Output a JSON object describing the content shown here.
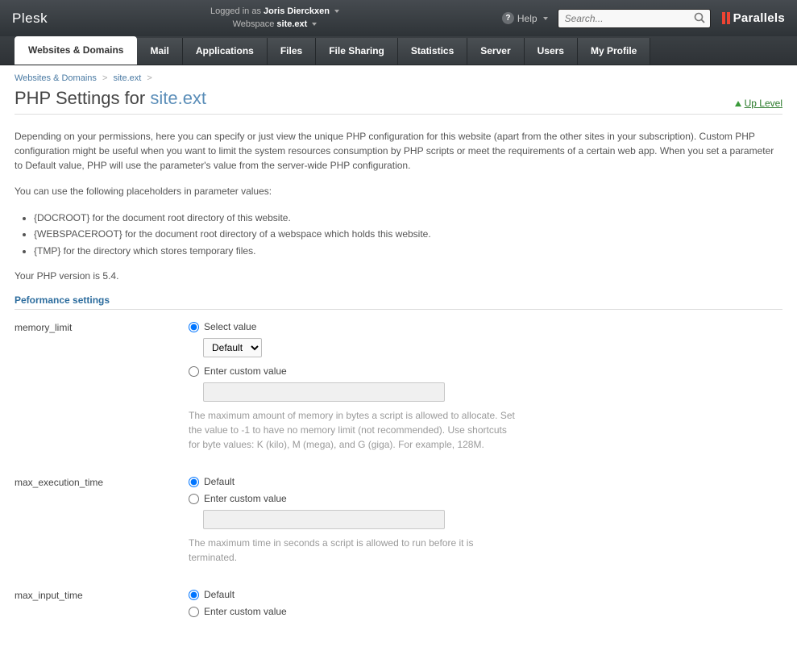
{
  "header": {
    "brand": "Plesk",
    "logged_in_label": "Logged in as",
    "user": "Joris Dierckxen",
    "webspace_label": "Webspace",
    "webspace": "site.ext",
    "help": "Help",
    "search_placeholder": "Search...",
    "parallels": "Parallels"
  },
  "nav": {
    "tabs": [
      {
        "label": "Websites & Domains",
        "active": true
      },
      {
        "label": "Mail"
      },
      {
        "label": "Applications"
      },
      {
        "label": "Files"
      },
      {
        "label": "File Sharing"
      },
      {
        "label": "Statistics"
      },
      {
        "label": "Server"
      },
      {
        "label": "Users"
      },
      {
        "label": "My Profile"
      }
    ]
  },
  "breadcrumbs": {
    "items": [
      {
        "label": "Websites & Domains"
      },
      {
        "label": "site.ext"
      }
    ]
  },
  "page": {
    "title_prefix": "PHP Settings for ",
    "title_ext": "site.ext",
    "up_level": "Up Level",
    "description": "Depending on your permissions, here you can specify or just view the unique PHP configuration for this website (apart from the other sites in your subscription). Custom PHP configuration might be useful when you want to limit the system resources consumption by PHP scripts or meet the requirements of a certain web app. When you set a parameter to Default value, PHP will use the parameter's value from the server-wide PHP configuration.",
    "placeholders_intro": "You can use the following placeholders in parameter values:",
    "placeholders": [
      "{DOCROOT} for the document root directory of this website.",
      "{WEBSPACEROOT} for the document root directory of a webspace which holds this website.",
      "{TMP} for the directory which stores temporary files."
    ],
    "php_version": "Your PHP version is 5.4.",
    "section_title": "Peformance settings"
  },
  "settings": {
    "memory_limit": {
      "label": "memory_limit",
      "opt1": "Select value",
      "select_value": "Default",
      "opt2": "Enter custom value",
      "hint": "The maximum amount of memory in bytes a script is allowed to allocate. Set the value to -1 to have no memory limit (not recommended). Use shortcuts for byte values: K (kilo), M (mega), and G (giga). For example, 128M."
    },
    "max_execution_time": {
      "label": "max_execution_time",
      "opt1": "Default",
      "opt2": "Enter custom value",
      "hint": "The maximum time in seconds a script is allowed to run before it is terminated."
    },
    "max_input_time": {
      "label": "max_input_time",
      "opt1": "Default",
      "opt2": "Enter custom value"
    }
  }
}
